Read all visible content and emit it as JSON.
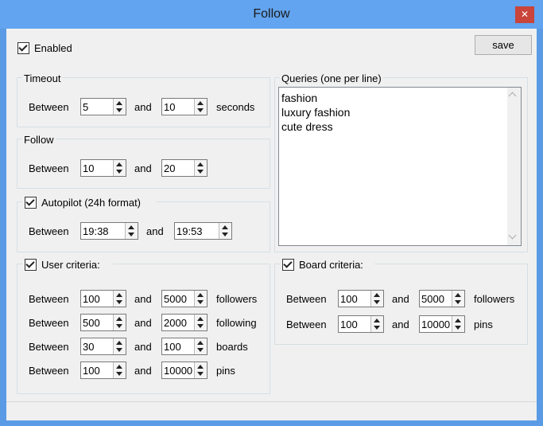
{
  "window": {
    "title": "Follow",
    "close_glyph": "✕"
  },
  "enabled": {
    "label": "Enabled",
    "checked": true
  },
  "save_label": "save",
  "timeout": {
    "title": "Timeout",
    "prefix": "Between",
    "from": "5",
    "conj": "and",
    "to": "10",
    "unit": "seconds"
  },
  "follow": {
    "title": "Follow",
    "prefix": "Between",
    "from": "10",
    "conj": "and",
    "to": "20"
  },
  "autopilot": {
    "title": "Autopilot (24h format)",
    "checked": true,
    "prefix": "Between",
    "from": "19:38",
    "conj": "and",
    "to": "19:53"
  },
  "user_criteria": {
    "title": "User criteria:",
    "checked": true,
    "rows": [
      {
        "prefix": "Between",
        "from": "100",
        "conj": "and",
        "to": "5000",
        "unit": "followers"
      },
      {
        "prefix": "Between",
        "from": "500",
        "conj": "and",
        "to": "2000",
        "unit": "following"
      },
      {
        "prefix": "Between",
        "from": "30",
        "conj": "and",
        "to": "100",
        "unit": "boards"
      },
      {
        "prefix": "Between",
        "from": "100",
        "conj": "and",
        "to": "10000",
        "unit": "pins"
      }
    ]
  },
  "queries": {
    "title": "Queries (one per line)",
    "lines": [
      "fashion",
      "luxury fashion",
      "cute dress"
    ]
  },
  "board_criteria": {
    "title": "Board criteria:",
    "checked": true,
    "rows": [
      {
        "prefix": "Between",
        "from": "100",
        "conj": "and",
        "to": "5000",
        "unit": "followers"
      },
      {
        "prefix": "Between",
        "from": "100",
        "conj": "and",
        "to": "10000",
        "unit": "pins"
      }
    ]
  }
}
